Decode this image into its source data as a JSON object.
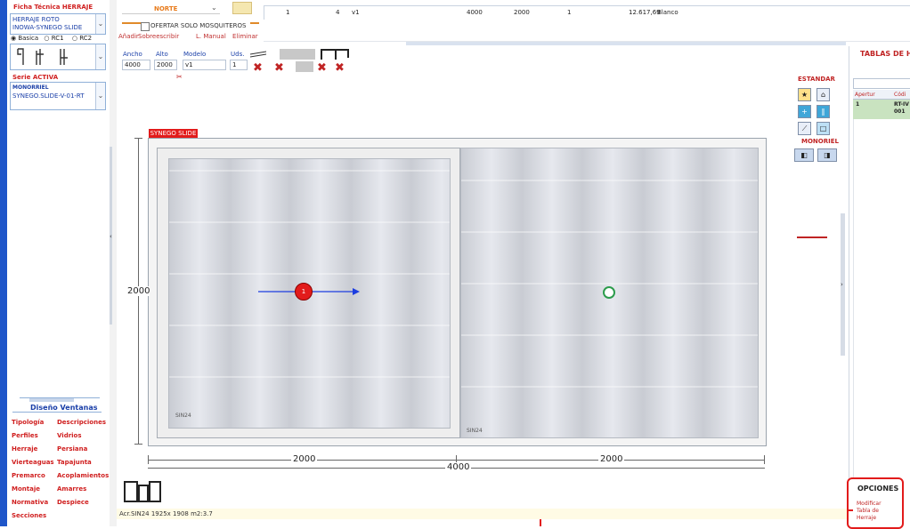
{
  "left": {
    "ficha_title": "Ficha Técnica HERRAJE",
    "herraje_line1": "HERRAJE ROTO",
    "herraje_line2": "INOWA-SYNEGO SLIDE",
    "radios": [
      "Basica",
      "RC1",
      "RC2"
    ],
    "serie_activa_label": "Serie ACTIVA",
    "monorriel_label": "MONORRIEL",
    "serie_value": "SYNEGO.SLIDE-V-01-RT",
    "diseno_title": "Diseño Ventanas",
    "menu_col1": [
      "Tipología",
      "Perfiles",
      "Herraje",
      "Vierteaguas",
      "Premarco",
      "Montaje",
      "Normativa",
      "Secciones"
    ],
    "menu_col2": [
      "Descripciones",
      "Vidrios",
      "Persiana",
      "Tapajunta",
      "Acoplamientos",
      "Amarres",
      "Despiece"
    ]
  },
  "toolbar": {
    "orientation": "NORTE",
    "checkbox_label": "OFERTAR SOLO MOSQUITEROS",
    "buttons": [
      "Añadir",
      "Sobreescribir",
      "L. Manual",
      "Eliminar"
    ]
  },
  "grid_row": {
    "c1": "1",
    "c2": "4",
    "c3": "v1",
    "c4": "4000",
    "c5": "2000",
    "c6": "1",
    "c7": "12.617,69",
    "c8": "Blanco"
  },
  "dims": {
    "ancho_label": "Ancho",
    "alto_label": "Alto",
    "modelo_label": "Modelo",
    "uds_label": "Uds.",
    "ancho": "4000",
    "alto": "2000",
    "modelo": "v1",
    "uds": "1"
  },
  "drawing": {
    "serie_tag": "SYNEGO SLIDE",
    "height_label": "2000",
    "width_left": "2000",
    "width_right": "2000",
    "width_total": "4000",
    "glass_left": "SIN24",
    "glass_right": "SIN24",
    "leaf_number": "1"
  },
  "right_tools": {
    "estandar": "ESTANDAR",
    "monoriel": "MONORIEL"
  },
  "right_panel": {
    "title": "TABLAS DE HE",
    "col1": "Apertur",
    "col2": "Códi",
    "row_c1": "1",
    "row_c2a": "RT-IV",
    "row_c2b": "001",
    "opciones": "OPCIONES",
    "opt1": "Modificar",
    "opt2": "Tabla de",
    "opt3": "Herraje"
  },
  "status": {
    "text": "Acr.SIN24 1925x 1908 m2:3.7"
  },
  "colors": {
    "accent_red": "#e21b1b",
    "accent_blue": "#1f56c9",
    "arrow_blue": "#1c3de0",
    "open_green": "#2c9c4c"
  }
}
